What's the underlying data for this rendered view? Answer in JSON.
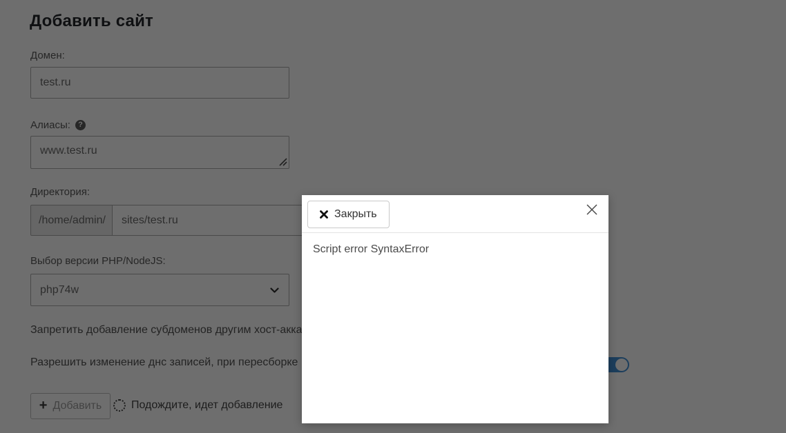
{
  "page": {
    "title": "Добавить сайт"
  },
  "form": {
    "domain_label": "Домен:",
    "domain_value": "test.ru",
    "aliases_label": "Алиасы:",
    "aliases_value": "www.test.ru",
    "directory_label": "Директория:",
    "directory_prefix": "/home/admin/",
    "directory_value": "sites/test.ru",
    "php_label": "Выбор версии PHP/NodeJS:",
    "php_selected": "php74w",
    "option_forbid_subdomains": "Запретить добавление субдоменов другим хост-акка",
    "option_allow_dns": "Разрешить изменение днс записей, при пересборке",
    "dns_toggle_state": "on",
    "submit_label": "Добавить",
    "submit_disabled": true,
    "progress_text": "Подождите, идет добавление"
  },
  "modal": {
    "close_button_label": "Закрыть",
    "body_text": "Script error SyntaxError"
  },
  "icons": {
    "help": "?",
    "plus": "+"
  },
  "colors": {
    "toggle_on": "#418fd5",
    "overlay": "rgba(0,0,0,0.57)",
    "modal_bg": "#ffffff"
  }
}
